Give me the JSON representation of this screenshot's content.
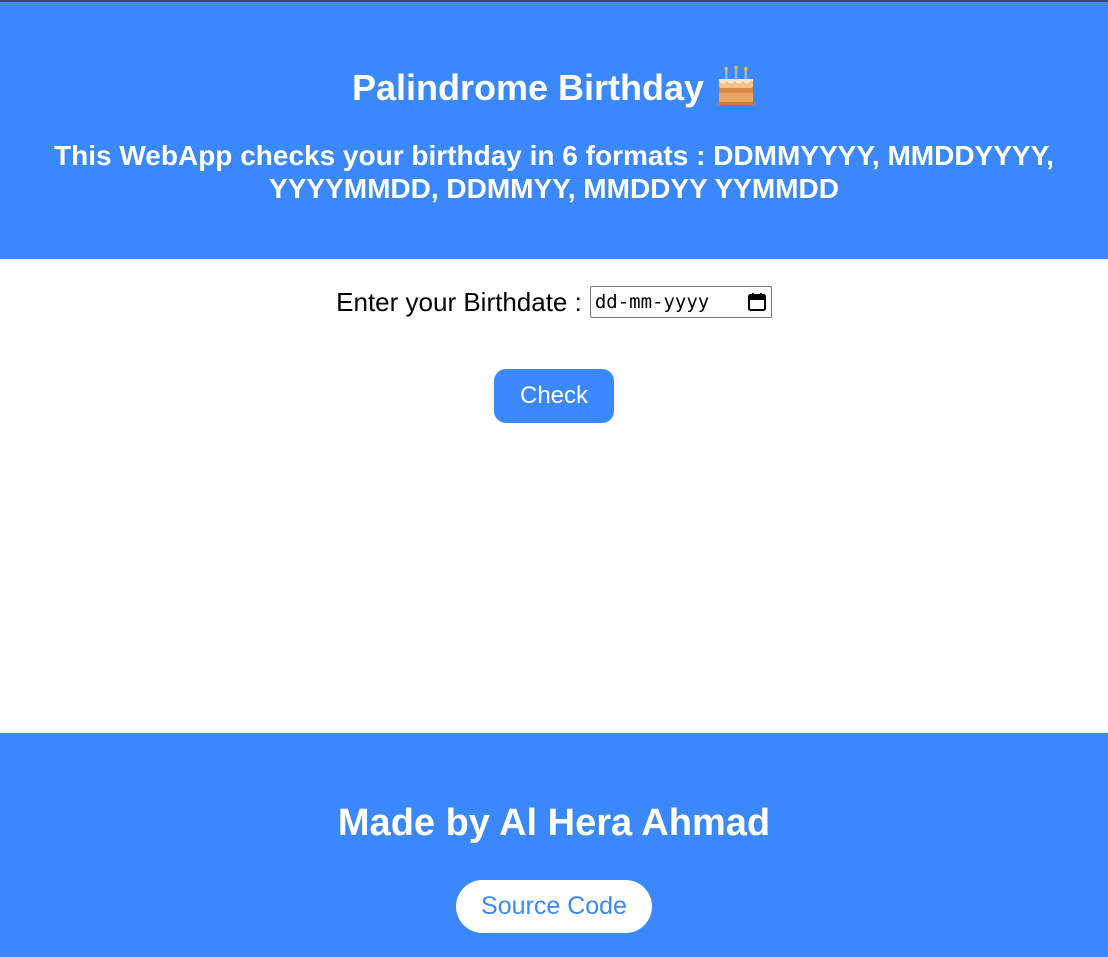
{
  "header": {
    "title": "Palindrome Birthday",
    "title_icon": "birthday-cake-icon",
    "subtitle": "This WebApp checks your birthday in 6 formats : DDMMYYYY, MMDDYYYY, YYYYMMDD, DDMMYY, MMDDYY YYMMDD"
  },
  "form": {
    "label": "Enter your Birthdate :",
    "date_placeholder": "dd-mm-yyyy",
    "date_icon": "calendar-icon",
    "check_label": "Check"
  },
  "footer": {
    "credit": "Made by Al Hera Ahmad",
    "source_label": "Source Code"
  },
  "colors": {
    "accent": "#3b88fd",
    "text_on_accent": "#ffffff"
  }
}
